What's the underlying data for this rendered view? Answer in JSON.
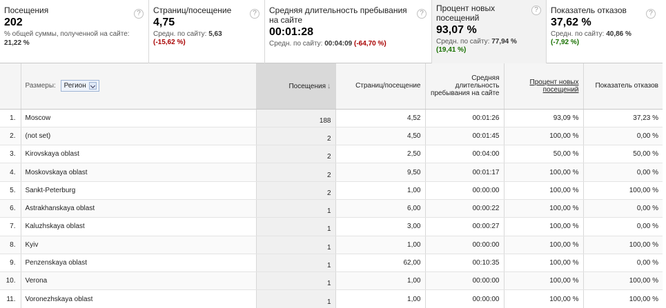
{
  "scorecards": [
    {
      "title": "Посещения",
      "value": "202",
      "sub_text": "% общей суммы, полученной на сайте:",
      "sub_value": "21,22 %",
      "delta": "",
      "delta_type": "",
      "help": "?"
    },
    {
      "title": "Страниц/посещение",
      "value": "4,75",
      "sub_text": "Средн. по сайту:",
      "sub_value": "5,63",
      "delta": "(-15,62 %)",
      "delta_type": "neg",
      "help": "?"
    },
    {
      "title": "Средняя длительность пребывания на сайте",
      "value": "00:01:28",
      "sub_text": "Средн. по сайту:",
      "sub_value": "00:04:09",
      "delta": "(-64,70 %)",
      "delta_type": "neg",
      "help": "?"
    },
    {
      "title": "Процент новых посещений",
      "value": "93,07 %",
      "sub_text": "Средн. по сайту:",
      "sub_value": "77,94 %",
      "delta": "(19,41 %)",
      "delta_type": "pos",
      "help": "?"
    },
    {
      "title": "Показатель отказов",
      "value": "37,62 %",
      "sub_text": "Средн. по сайту:",
      "sub_value": "40,86 %",
      "delta": "(-7,92 %)",
      "delta_type": "pos",
      "help": "?"
    }
  ],
  "table": {
    "dimension_label": "Размеры:",
    "dimension_value": "Регион",
    "sort_icon": "arrow-down-icon",
    "columns": [
      "Посещения",
      "Страниц/посещение",
      "Средняя длительность пребывания на сайте",
      "Процент новых посещений",
      "Показатель отказов"
    ],
    "rows": [
      {
        "n": "1.",
        "name": "Moscow",
        "visits": "188",
        "pps": "4,52",
        "dur": "00:01:26",
        "new": "93,09 %",
        "bounce": "37,23 %"
      },
      {
        "n": "2.",
        "name": "(not set)",
        "visits": "2",
        "pps": "4,50",
        "dur": "00:01:45",
        "new": "100,00 %",
        "bounce": "0,00 %"
      },
      {
        "n": "3.",
        "name": "Kirovskaya oblast",
        "visits": "2",
        "pps": "2,50",
        "dur": "00:04:00",
        "new": "50,00 %",
        "bounce": "50,00 %"
      },
      {
        "n": "4.",
        "name": "Moskovskaya oblast",
        "visits": "2",
        "pps": "9,50",
        "dur": "00:01:17",
        "new": "100,00 %",
        "bounce": "0,00 %"
      },
      {
        "n": "5.",
        "name": "Sankt-Peterburg",
        "visits": "2",
        "pps": "1,00",
        "dur": "00:00:00",
        "new": "100,00 %",
        "bounce": "100,00 %"
      },
      {
        "n": "6.",
        "name": "Astrakhanskaya oblast",
        "visits": "1",
        "pps": "6,00",
        "dur": "00:00:22",
        "new": "100,00 %",
        "bounce": "0,00 %"
      },
      {
        "n": "7.",
        "name": "Kaluzhskaya oblast",
        "visits": "1",
        "pps": "3,00",
        "dur": "00:00:27",
        "new": "100,00 %",
        "bounce": "0,00 %"
      },
      {
        "n": "8.",
        "name": "Kyiv",
        "visits": "1",
        "pps": "1,00",
        "dur": "00:00:00",
        "new": "100,00 %",
        "bounce": "100,00 %"
      },
      {
        "n": "9.",
        "name": "Penzenskaya oblast",
        "visits": "1",
        "pps": "62,00",
        "dur": "00:10:35",
        "new": "100,00 %",
        "bounce": "0,00 %"
      },
      {
        "n": "10.",
        "name": "Verona",
        "visits": "1",
        "pps": "1,00",
        "dur": "00:00:00",
        "new": "100,00 %",
        "bounce": "100,00 %"
      },
      {
        "n": "11.",
        "name": "Voronezhskaya oblast",
        "visits": "1",
        "pps": "1,00",
        "dur": "00:00:00",
        "new": "100,00 %",
        "bounce": "100,00 %"
      }
    ]
  }
}
